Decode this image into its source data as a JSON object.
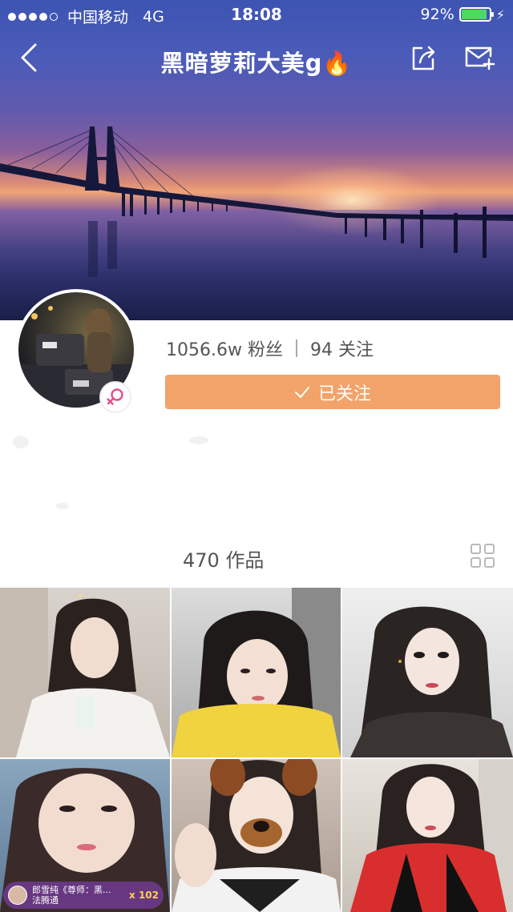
{
  "status_bar": {
    "carrier": "中国移动",
    "network": "4G",
    "time": "18:08",
    "battery": "92%",
    "battery_level": 0.92
  },
  "nav": {
    "title": "黑暗萝莉大美g",
    "title_emoji": "🔥"
  },
  "profile": {
    "fans": "1056.6w 粉丝",
    "following": "94 关注",
    "follow_button": "已关注",
    "gender": "female"
  },
  "works": {
    "count_label": "470 作品"
  },
  "thumbnails": [
    {
      "id": 1,
      "caption": ""
    },
    {
      "id": 2,
      "caption": ""
    },
    {
      "id": 3,
      "caption": ""
    },
    {
      "id": 4,
      "live_name": "郎雪纯《尊师：黑...",
      "live_sub": "法腾通",
      "live_gift": "x 102"
    },
    {
      "id": 5,
      "caption": ""
    },
    {
      "id": 6,
      "caption": ""
    }
  ],
  "colors": {
    "accent_button": "#f2a36a",
    "battery_fill": "#4cd964",
    "gender_pink": "#e0508a"
  },
  "icons": {
    "back": "chevron-left-icon",
    "share": "share-icon",
    "mail": "mail-add-icon",
    "gender": "female-icon",
    "check": "check-icon",
    "grid": "grid-icon"
  }
}
